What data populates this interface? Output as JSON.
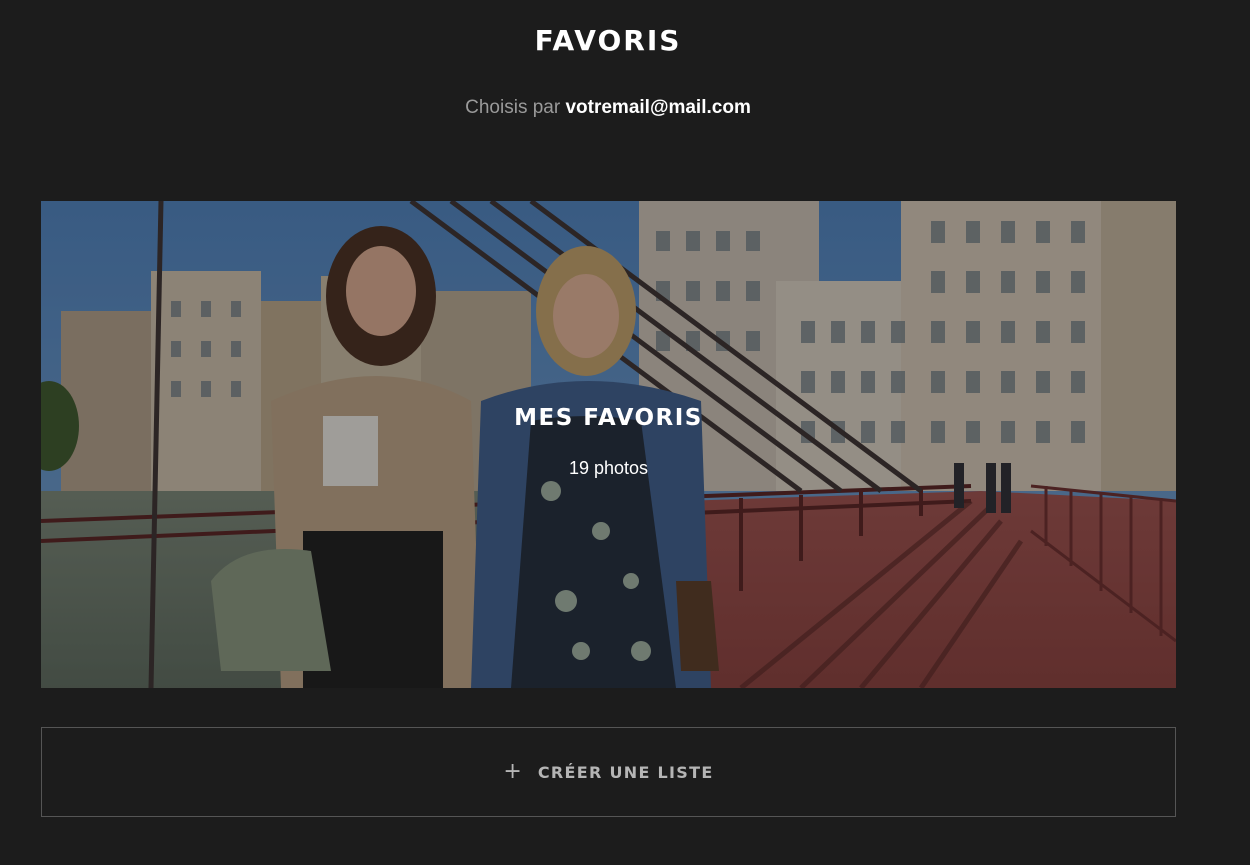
{
  "header": {
    "title": "FAVORIS",
    "subtitle_prefix": "Choisis par",
    "owner_email": "votremail@mail.com"
  },
  "favorites_card": {
    "title": "MES FAVORIS",
    "photo_count": "19 photos",
    "image_description": "photo-two-women-on-red-footbridge-lyon"
  },
  "create_list": {
    "icon": "plus-icon",
    "label": "CRÉER UNE LISTE"
  },
  "colors": {
    "background": "#1c1c1c",
    "text_primary": "#ffffff",
    "text_muted": "#9a9a9a",
    "button_border": "#555555"
  }
}
